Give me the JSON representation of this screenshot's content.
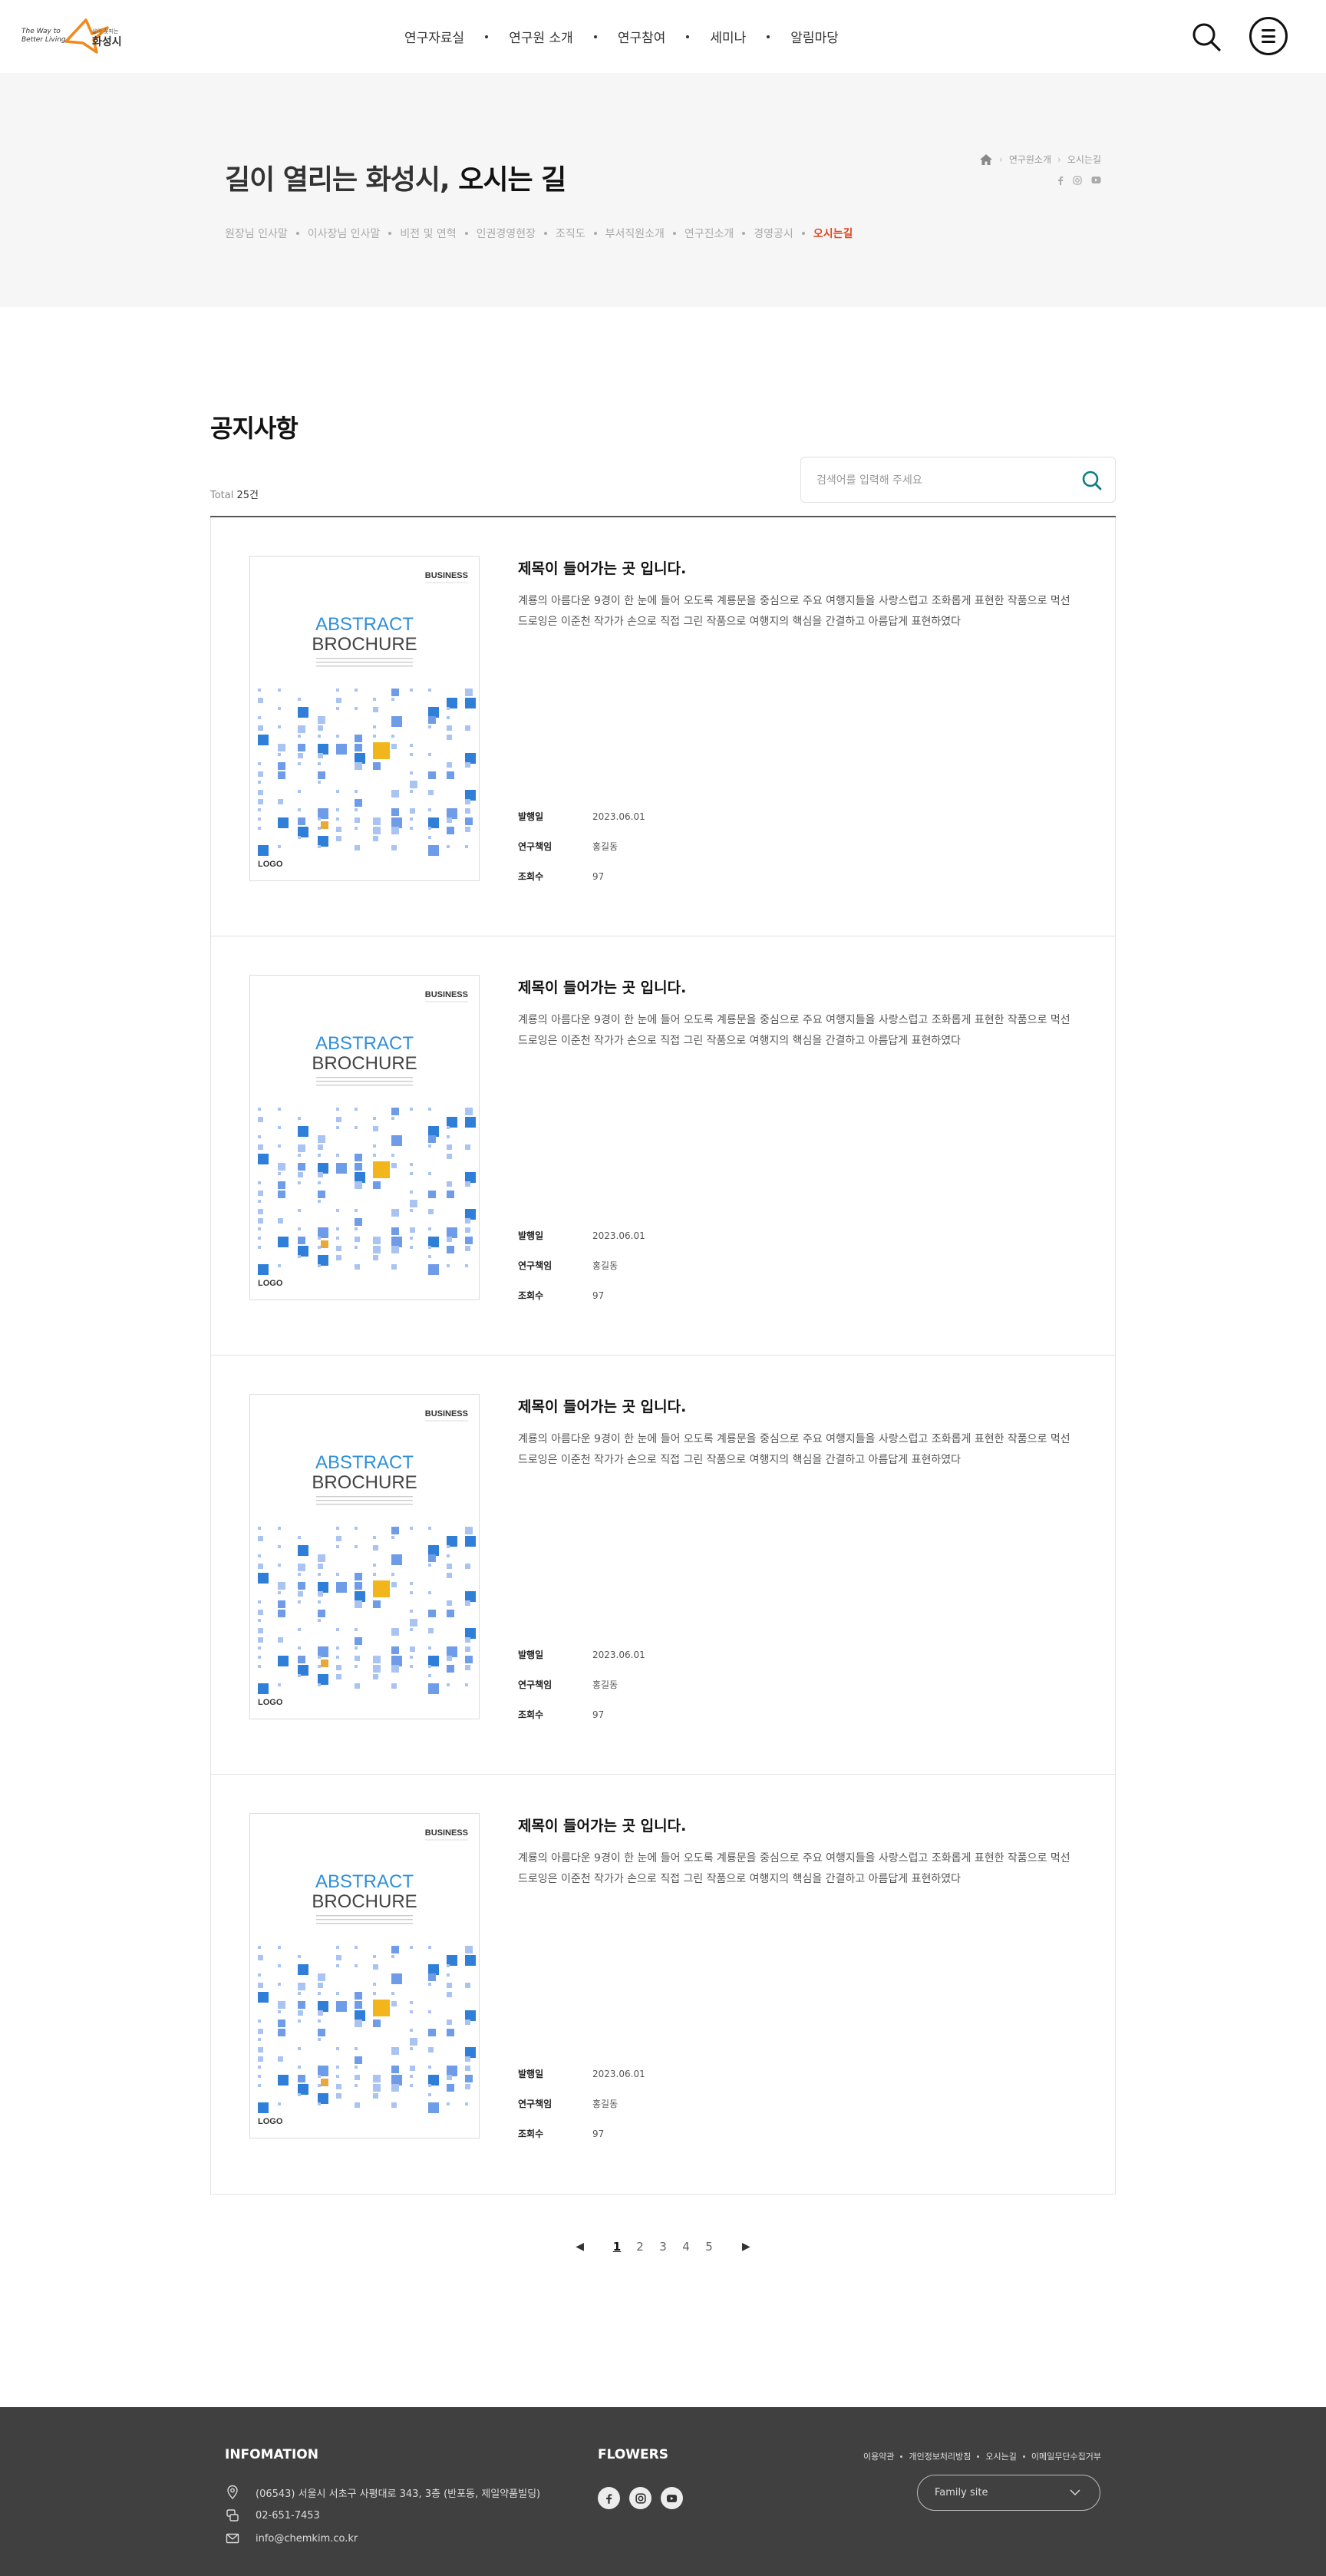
{
  "brand": {
    "tagline": "The Way to Better Living",
    "small": "삶이 꽃피는",
    "name": "화성시",
    "colors": {
      "accent": "#e0471f",
      "logo_orange": "#f08a1c"
    }
  },
  "gnb": [
    "연구자료실",
    "연구원 소개",
    "연구참여",
    "세미나",
    "알림마당"
  ],
  "header_icons": {
    "search": "search-icon",
    "menu": "menu-icon"
  },
  "subvisual": {
    "title_light": "길이 열리는 화성시,",
    "title_bold": "오시는 길",
    "breadcrumb": [
      "연구원소개",
      "오시는길"
    ],
    "subnav": [
      "원장님 인사말",
      "이사장님 인사말",
      "비전 및 연혁",
      "인권경영현장",
      "조직도",
      "부서직원소개",
      "연구진소개",
      "경영공시",
      "오시는길"
    ],
    "subnav_active": "오시는길"
  },
  "main": {
    "title": "공지사항",
    "total_label": "Total",
    "total_count": "25건",
    "search_placeholder": "검색어를 입력해 주세요"
  },
  "thumb": {
    "tag": "BUSINESS",
    "line1": "ABSTRACT",
    "line2": "BROCHURE",
    "logo": "LOGO"
  },
  "meta_labels": {
    "date": "발행일",
    "author": "연구책임",
    "views": "조회수"
  },
  "posts": [
    {
      "title": "제목이 들어가는 곳 입니다.",
      "desc": "계룡의 아름다운 9경이 한 눈에 들어 오도록 계룡문을 중심으로 주요 여행지들을 사랑스럽고 조화롭게 표현한 작품으로 먹선 드로잉은 이준천 작가가 손으로 직접 그린 작품으로 여행지의 핵심을 간결하고 아름답게 표현하였다",
      "date": "2023.06.01",
      "author": "홍길동",
      "views": "97"
    },
    {
      "title": "제목이 들어가는 곳 입니다.",
      "desc": "계룡의 아름다운 9경이 한 눈에 들어 오도록 계룡문을 중심으로 주요 여행지들을 사랑스럽고 조화롭게 표현한 작품으로 먹선 드로잉은 이준천 작가가 손으로 직접 그린 작품으로 여행지의 핵심을 간결하고 아름답게 표현하였다",
      "date": "2023.06.01",
      "author": "홍길동",
      "views": "97"
    },
    {
      "title": "제목이 들어가는 곳 입니다.",
      "desc": "계룡의 아름다운 9경이 한 눈에 들어 오도록 계룡문을 중심으로 주요 여행지들을 사랑스럽고 조화롭게 표현한 작품으로 먹선 드로잉은 이준천 작가가 손으로 직접 그린 작품으로 여행지의 핵심을 간결하고 아름답게 표현하였다",
      "date": "2023.06.01",
      "author": "홍길동",
      "views": "97"
    },
    {
      "title": "제목이 들어가는 곳 입니다.",
      "desc": "계룡의 아름다운 9경이 한 눈에 들어 오도록 계룡문을 중심으로 주요 여행지들을 사랑스럽고 조화롭게 표현한 작품으로 먹선 드로잉은 이준천 작가가 손으로 직접 그린 작품으로 여행지의 핵심을 간결하고 아름답게 표현하였다",
      "date": "2023.06.01",
      "author": "홍길동",
      "views": "97"
    }
  ],
  "pagination": {
    "prev": "◀",
    "next": "▶",
    "pages": [
      "1",
      "2",
      "3",
      "4",
      "5"
    ],
    "current": "1"
  },
  "footer": {
    "info_title": "INFOMATION",
    "address": "(06543) 서울시 서초구 사평대로 343, 3층 (반포동, 제일약품빌딩)",
    "phone": "02-651-7453",
    "email": "info@chemkim.co.kr",
    "flowers_title": "FLOWERS",
    "social": [
      "facebook-icon",
      "instagram-icon",
      "youtube-icon"
    ],
    "links": [
      "이용약관",
      "개인정보처리방침",
      "오시는길",
      "이메일무단수집거부"
    ],
    "family_site": "Family site"
  }
}
